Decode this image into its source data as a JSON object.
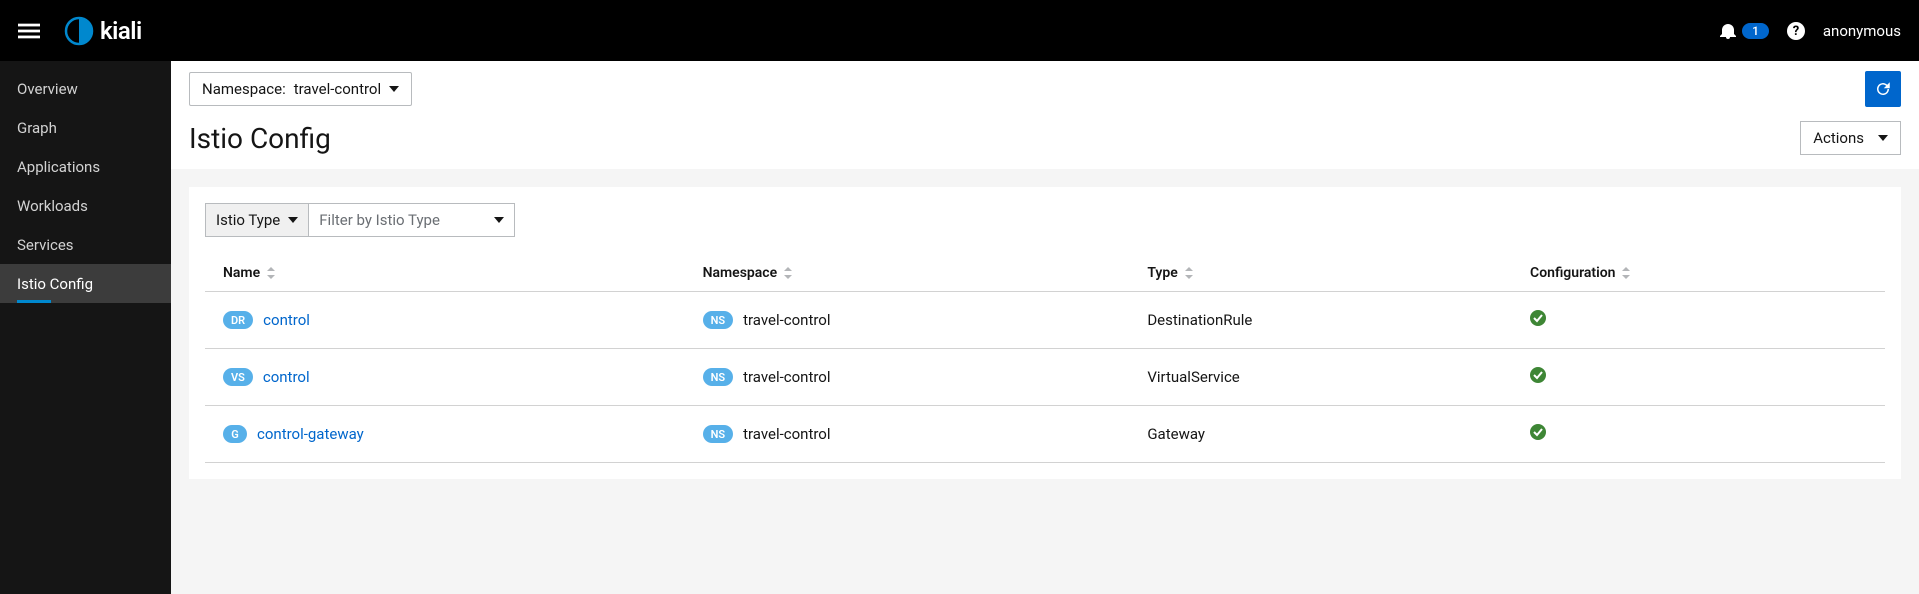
{
  "header": {
    "brand": "kiali",
    "notification_count": "1",
    "user": "anonymous"
  },
  "sidebar": {
    "items": [
      {
        "label": "Overview"
      },
      {
        "label": "Graph"
      },
      {
        "label": "Applications"
      },
      {
        "label": "Workloads"
      },
      {
        "label": "Services"
      },
      {
        "label": "Istio Config"
      }
    ],
    "active_index": 5
  },
  "toolbar": {
    "namespace_label": "Namespace:",
    "namespace_value": "travel-control",
    "page_title": "Istio Config",
    "actions_label": "Actions"
  },
  "filter": {
    "attribute_label": "Istio Type",
    "value_placeholder": "Filter by Istio Type"
  },
  "table": {
    "columns": {
      "name": "Name",
      "namespace": "Namespace",
      "type": "Type",
      "configuration": "Configuration"
    },
    "rows": [
      {
        "badge": "DR",
        "name": "control",
        "namespace": "travel-control",
        "type": "DestinationRule",
        "config": "ok"
      },
      {
        "badge": "VS",
        "name": "control",
        "namespace": "travel-control",
        "type": "VirtualService",
        "config": "ok"
      },
      {
        "badge": "G",
        "name": "control-gateway",
        "namespace": "travel-control",
        "type": "Gateway",
        "config": "ok"
      }
    ],
    "ns_badge": "NS"
  }
}
